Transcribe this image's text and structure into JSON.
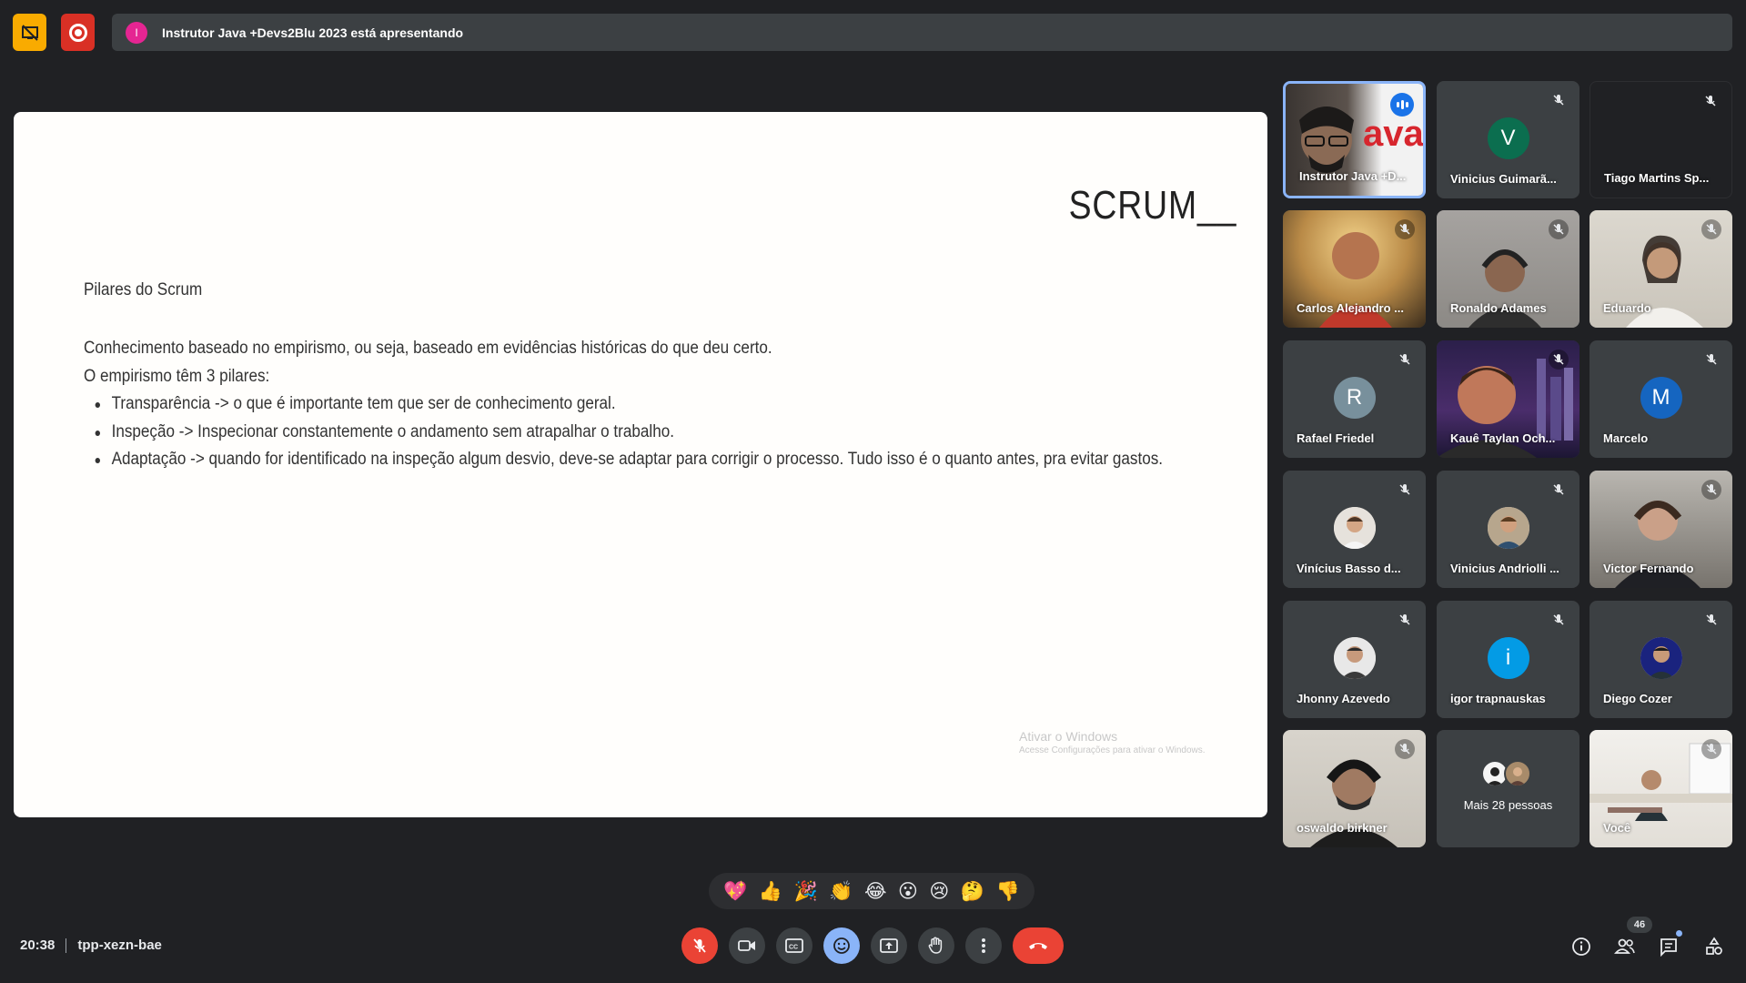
{
  "banner": {
    "avatar_letter": "I",
    "text": "Instrutor Java +Devs2Blu 2023 está apresentando"
  },
  "slide": {
    "logo": "SCRUM__",
    "heading": "Pilares do Scrum",
    "line1": "Conhecimento baseado no empirismo, ou seja, baseado em evidências históricas do que deu certo.",
    "line2": "O empirismo têm 3 pilares:",
    "bullets": [
      "Transparência -> o que é importante tem que ser de conhecimento geral.",
      "Inspeção -> Inspecionar constantemente o andamento sem atrapalhar o trabalho.",
      "Adaptação -> quando for identificado na inspeção algum desvio, deve-se adaptar para corrigir o processo. Tudo isso é o quanto antes, pra evitar gastos."
    ],
    "watermark_title": "Ativar o Windows",
    "watermark_sub": "Acesse Configurações para ativar o Windows."
  },
  "participants": [
    {
      "name": "Instrutor Java +D...",
      "kind": "video",
      "speaking": true
    },
    {
      "name": "Vinicius Guimarã...",
      "kind": "letter",
      "letter": "V",
      "color": "#0b6e4f"
    },
    {
      "name": "Tiago Martins Sp...",
      "kind": "dark"
    },
    {
      "name": "Carlos Alejandro ...",
      "kind": "video"
    },
    {
      "name": "Ronaldo Adames",
      "kind": "video"
    },
    {
      "name": "Eduardo",
      "kind": "video"
    },
    {
      "name": "Rafael Friedel",
      "kind": "letter",
      "letter": "R",
      "color": "#78909c"
    },
    {
      "name": "Kauê Taylan Och...",
      "kind": "video"
    },
    {
      "name": "Marcelo",
      "kind": "letter",
      "letter": "M",
      "color": "#1565c0"
    },
    {
      "name": "Vinícius Basso d...",
      "kind": "photo"
    },
    {
      "name": "Vinicius Andriolli ...",
      "kind": "photo"
    },
    {
      "name": "Victor Fernando",
      "kind": "video"
    },
    {
      "name": "Jhonny Azevedo",
      "kind": "photo"
    },
    {
      "name": "igor trapnauskas",
      "kind": "letter",
      "letter": "i",
      "color": "#039be5"
    },
    {
      "name": "Diego Cozer",
      "kind": "photo"
    },
    {
      "name": "oswaldo birkner",
      "kind": "video"
    },
    {
      "name": "Mais 28 pessoas",
      "kind": "more"
    },
    {
      "name": "Você",
      "kind": "video"
    }
  ],
  "reactions": [
    "💖",
    "👍",
    "🎉",
    "👏",
    "😂",
    "😮",
    "😢",
    "🤔",
    "👎"
  ],
  "meeting": {
    "time": "20:38",
    "code": "tpp-xezn-bae",
    "participant_count": "46"
  },
  "colors": {
    "background": "#202124",
    "tile": "#3c4043",
    "hangup": "#ea4335",
    "accent": "#8ab4f8"
  }
}
